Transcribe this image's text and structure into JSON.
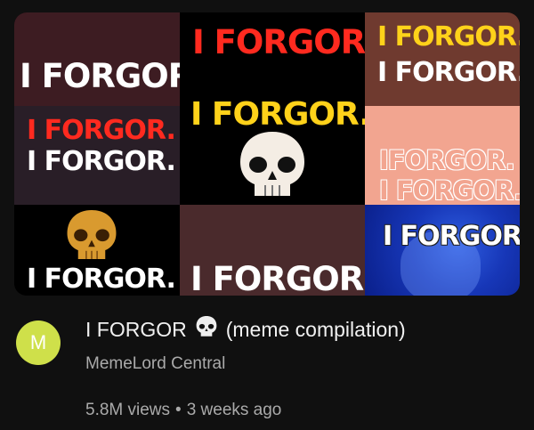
{
  "thumbnail": {
    "texts": {
      "c1_line1": "I FORGOR.",
      "c2_line1": "I FORGOR.",
      "c2_line2": "I FORGOR.",
      "c3_line1": "I FORGOR",
      "c3_line2": "I FORGOR.",
      "c4_line1": "I FORGOR.",
      "c4_line2": "I FORGOR.",
      "c5_line1": "IFORGOR.",
      "c5_line2": "I FORGOR.",
      "c6_line1": "I FORGOR.",
      "c7_line1": "I FORGOR.",
      "c8_line1": "I FORGOR."
    },
    "icons": [
      "skull-icon",
      "skull-icon"
    ]
  },
  "video": {
    "avatar_letter": "M",
    "title_before": "I FORGOR",
    "title_after": "(meme compilation)",
    "channel": "MemeLord Central",
    "views": "5.8M views",
    "separator": "•",
    "age": "3 weeks ago"
  },
  "colors": {
    "background": "#101010",
    "avatar": "#cfe04a",
    "title_text": "#f1f1f1",
    "secondary_text": "#aaaaaa",
    "meme_red": "#ff2a1f",
    "meme_yellow": "#ffd21a"
  }
}
